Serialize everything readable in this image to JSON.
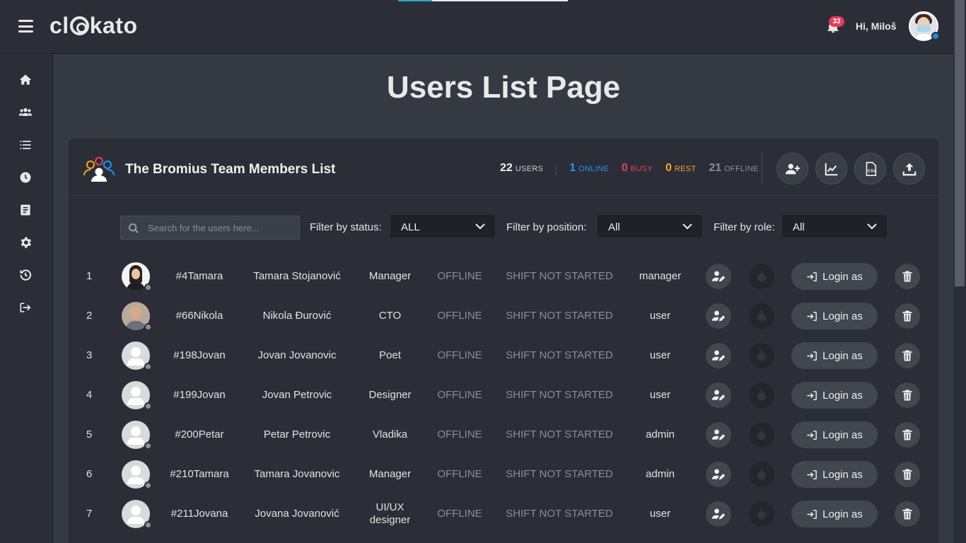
{
  "header": {
    "logo": "clekato",
    "logo_parts": [
      "cl",
      "kato"
    ],
    "notification_count": "33",
    "greeting": "Hi, Miloš"
  },
  "sidebar": {
    "items": [
      {
        "name": "home",
        "icon": "home-icon"
      },
      {
        "name": "users",
        "icon": "users-icon"
      },
      {
        "name": "tasks",
        "icon": "list-icon"
      },
      {
        "name": "time",
        "icon": "clock-icon"
      },
      {
        "name": "reports",
        "icon": "report-icon"
      },
      {
        "name": "settings",
        "icon": "gear-icon"
      },
      {
        "name": "history",
        "icon": "history-icon"
      },
      {
        "name": "logout",
        "icon": "logout-icon"
      }
    ]
  },
  "page": {
    "title": "Users List Page"
  },
  "card": {
    "title": "The Bromius Team Members List",
    "stats": {
      "users": {
        "value": "22",
        "label": "USERS"
      },
      "online": {
        "value": "1",
        "label": "ONLINE",
        "color": "#2196f3"
      },
      "busy": {
        "value": "0",
        "label": "BUSY",
        "color": "#e8405e"
      },
      "rest": {
        "value": "0",
        "label": "REST",
        "color": "#f5a623"
      },
      "offline": {
        "value": "21",
        "label": "OFFLINE",
        "color": "#8b8e94"
      }
    }
  },
  "filters": {
    "search_placeholder": "Search for the users here...",
    "status_label": "Filter by status:",
    "status_value": "ALL",
    "position_label": "Filter by position:",
    "position_value": "All",
    "role_label": "Filter by role:",
    "role_value": "All"
  },
  "rows": [
    {
      "idx": "1",
      "username": "#4Tamara",
      "name": "Tamara Stojanović",
      "position": "Manager",
      "status": "OFFLINE",
      "shift": "SHIFT NOT STARTED",
      "role": "manager",
      "login": "Login as",
      "avatar": "photo-f"
    },
    {
      "idx": "2",
      "username": "#66Nikola",
      "name": "Nikola Đurović",
      "position": "CTO",
      "status": "OFFLINE",
      "shift": "SHIFT NOT STARTED",
      "role": "user",
      "login": "Login as",
      "avatar": "photo-m"
    },
    {
      "idx": "3",
      "username": "#198Jovan",
      "name": "Jovan Jovanovic",
      "position": "Poet",
      "status": "OFFLINE",
      "shift": "SHIFT NOT STARTED",
      "role": "user",
      "login": "Login as",
      "avatar": "default"
    },
    {
      "idx": "4",
      "username": "#199Jovan",
      "name": "Jovan Petrovic",
      "position": "Designer",
      "status": "OFFLINE",
      "shift": "SHIFT NOT STARTED",
      "role": "user",
      "login": "Login as",
      "avatar": "default"
    },
    {
      "idx": "5",
      "username": "#200Petar",
      "name": "Petar Petrovic",
      "position": "Vladika",
      "status": "OFFLINE",
      "shift": "SHIFT NOT STARTED",
      "role": "admin",
      "login": "Login as",
      "avatar": "default"
    },
    {
      "idx": "6",
      "username": "#210Tamara",
      "name": "Tamara Jovanovic",
      "position": "Manager",
      "status": "OFFLINE",
      "shift": "SHIFT NOT STARTED",
      "role": "admin",
      "login": "Login as",
      "avatar": "default"
    },
    {
      "idx": "7",
      "username": "#211Jovana",
      "name": "Jovana Jovanović",
      "position": "UI/UX designer",
      "status": "OFFLINE",
      "shift": "SHIFT NOT STARTED",
      "role": "user",
      "login": "Login as",
      "avatar": "default"
    }
  ]
}
